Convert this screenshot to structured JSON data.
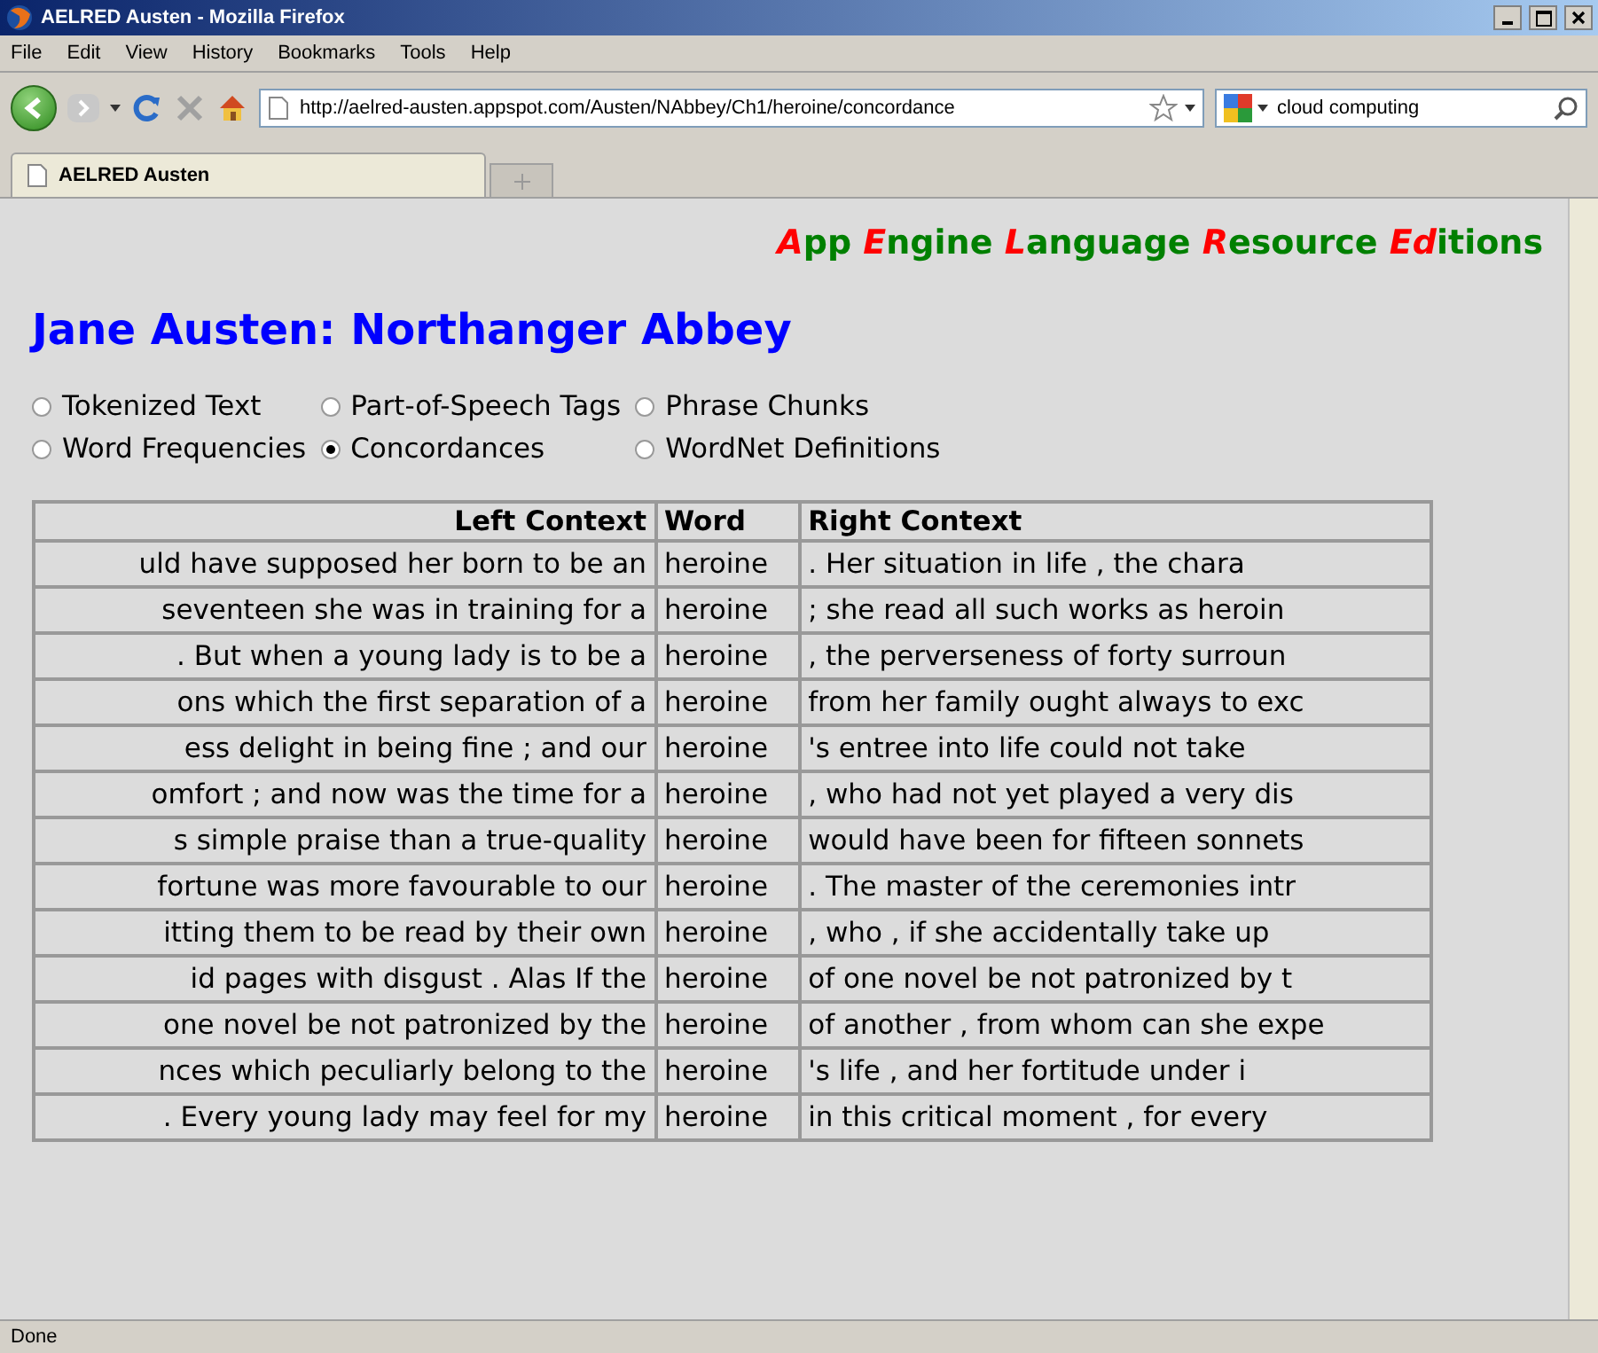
{
  "window": {
    "title": "AELRED Austen - Mozilla Firefox"
  },
  "menu": [
    "File",
    "Edit",
    "View",
    "History",
    "Bookmarks",
    "Tools",
    "Help"
  ],
  "address": {
    "value": "http://aelred-austen.appspot.com/Austen/NAbbey/Ch1/heroine/concordance"
  },
  "search": {
    "value": "cloud computing"
  },
  "tabs": [
    {
      "label": "AELRED Austen",
      "selected": true
    }
  ],
  "banner": [
    {
      "text": "A",
      "accent": true
    },
    {
      "text": "pp ",
      "accent": false
    },
    {
      "text": "E",
      "accent": true
    },
    {
      "text": "ngine ",
      "accent": false
    },
    {
      "text": "L",
      "accent": true
    },
    {
      "text": "anguage ",
      "accent": false
    },
    {
      "text": "R",
      "accent": true
    },
    {
      "text": "esource ",
      "accent": false
    },
    {
      "text": "Ed",
      "accent": true
    },
    {
      "text": "itions",
      "accent": false
    }
  ],
  "heading": "Jane Austen: Northanger Abbey",
  "views": [
    {
      "label": "Tokenized Text",
      "selected": false
    },
    {
      "label": "Part-of-Speech Tags",
      "selected": false
    },
    {
      "label": "Phrase Chunks",
      "selected": false
    },
    {
      "label": "Word Frequencies",
      "selected": false
    },
    {
      "label": "Concordances",
      "selected": true
    },
    {
      "label": "WordNet Definitions",
      "selected": false
    }
  ],
  "table": {
    "columns": [
      "Left Context",
      "Word",
      "Right Context"
    ],
    "rows": [
      [
        "uld have supposed her born to be an",
        "heroine",
        ". Her situation in life , the chara"
      ],
      [
        "seventeen she was in training for a",
        "heroine",
        "; she read all such works as heroin"
      ],
      [
        ". But when a young lady is to be a",
        "heroine",
        ", the perverseness of forty surroun"
      ],
      [
        "ons which the first separation of a",
        "heroine",
        "from her family ought always to exc"
      ],
      [
        "ess delight in being fine ; and our",
        "heroine",
        "'s entree into life could not take"
      ],
      [
        "omfort ; and now was the time for a",
        "heroine",
        ", who had not yet played a very dis"
      ],
      [
        "s simple praise than a true-quality",
        "heroine",
        "would have been for fifteen sonnets"
      ],
      [
        "fortune was more favourable to our",
        "heroine",
        ". The master of the ceremonies intr"
      ],
      [
        "itting them to be read by their own",
        "heroine",
        ", who , if she accidentally take up"
      ],
      [
        "id pages with disgust . Alas If the",
        "heroine",
        "of one novel be not patronized by t"
      ],
      [
        "one novel be not patronized by the",
        "heroine",
        "of another , from whom can she expe"
      ],
      [
        "nces which peculiarly belong to the",
        "heroine",
        "'s life , and her fortitude under i"
      ],
      [
        ". Every young lady may feel for my",
        "heroine",
        "in this critical moment , for every"
      ]
    ]
  },
  "status_bar": "Done"
}
